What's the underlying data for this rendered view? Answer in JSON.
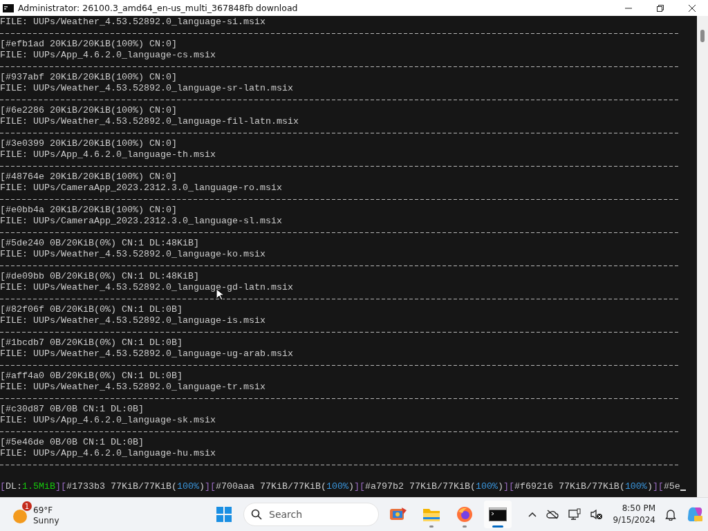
{
  "window": {
    "title": "Administrator:  26100.3_amd64_en-us_multi_367848fb download"
  },
  "console": {
    "first_line": "FILE: UUPs/Weather_4.53.52892.0_language-si.msix",
    "records": [
      {
        "header": "[#efb1ad 20KiB/20KiB(100%) CN:0]",
        "file": "FILE: UUPs/App_4.6.2.0_language-cs.msix"
      },
      {
        "header": "[#937abf 20KiB/20KiB(100%) CN:0]",
        "file": "FILE: UUPs/Weather_4.53.52892.0_language-sr-latn.msix"
      },
      {
        "header": "[#6e2286 20KiB/20KiB(100%) CN:0]",
        "file": "FILE: UUPs/Weather_4.53.52892.0_language-fil-latn.msix"
      },
      {
        "header": "[#3e0399 20KiB/20KiB(100%) CN:0]",
        "file": "FILE: UUPs/App_4.6.2.0_language-th.msix"
      },
      {
        "header": "[#48764e 20KiB/20KiB(100%) CN:0]",
        "file": "FILE: UUPs/CameraApp_2023.2312.3.0_language-ro.msix"
      },
      {
        "header": "[#e0bb4a 20KiB/20KiB(100%) CN:0]",
        "file": "FILE: UUPs/CameraApp_2023.2312.3.0_language-sl.msix"
      },
      {
        "header": "[#5de240 0B/20KiB(0%) CN:1 DL:48KiB]",
        "file": "FILE: UUPs/Weather_4.53.52892.0_language-ko.msix"
      },
      {
        "header": "[#de09bb 0B/20KiB(0%) CN:1 DL:48KiB]",
        "file": "FILE: UUPs/Weather_4.53.52892.0_language-gd-latn.msix"
      },
      {
        "header": "[#82f06f 0B/20KiB(0%) CN:1 DL:0B]",
        "file": "FILE: UUPs/Weather_4.53.52892.0_language-is.msix"
      },
      {
        "header": "[#1bcdb7 0B/20KiB(0%) CN:1 DL:0B]",
        "file": "FILE: UUPs/Weather_4.53.52892.0_language-ug-arab.msix"
      },
      {
        "header": "[#aff4a0 0B/20KiB(0%) CN:1 DL:0B]",
        "file": "FILE: UUPs/Weather_4.53.52892.0_language-tr.msix"
      },
      {
        "header": "[#c30d87 0B/0B CN:1 DL:0B]",
        "file": "FILE: UUPs/App_4.6.2.0_language-sk.msix"
      },
      {
        "header": "[#5e46de 0B/0B CN:1 DL:0B]",
        "file": "FILE: UUPs/App_4.6.2.0_language-hu.msix"
      }
    ],
    "status": [
      {
        "text": "[",
        "kind": "bracket"
      },
      {
        "text": "DL:",
        "kind": "plain"
      },
      {
        "text": "1.5MiB",
        "kind": "green"
      },
      {
        "text": "][",
        "kind": "bracket"
      },
      {
        "text": "#1733b3 77KiB/77KiB",
        "kind": "plain"
      },
      {
        "text": "(",
        "kind": "plain"
      },
      {
        "text": "100%",
        "kind": "blue"
      },
      {
        "text": ")",
        "kind": "plain"
      },
      {
        "text": "][",
        "kind": "bracket"
      },
      {
        "text": "#700aaa 77KiB/77KiB",
        "kind": "plain"
      },
      {
        "text": "(",
        "kind": "plain"
      },
      {
        "text": "100%",
        "kind": "blue"
      },
      {
        "text": ")",
        "kind": "plain"
      },
      {
        "text": "][",
        "kind": "bracket"
      },
      {
        "text": "#a797b2 77KiB/77KiB",
        "kind": "plain"
      },
      {
        "text": "(",
        "kind": "plain"
      },
      {
        "text": "100%",
        "kind": "blue"
      },
      {
        "text": ")",
        "kind": "plain"
      },
      {
        "text": "][",
        "kind": "bracket"
      },
      {
        "text": "#f69216 77KiB/77KiB",
        "kind": "plain"
      },
      {
        "text": "(",
        "kind": "plain"
      },
      {
        "text": "100%",
        "kind": "blue"
      },
      {
        "text": ")",
        "kind": "plain"
      },
      {
        "text": "][",
        "kind": "bracket"
      },
      {
        "text": "#5e",
        "kind": "plain"
      }
    ]
  },
  "taskbar": {
    "weather": {
      "badge": "1",
      "temperature": "69°F",
      "condition": "Sunny"
    },
    "search": {
      "placeholder": "Search"
    },
    "apps": [
      {
        "kind": "folder",
        "active": false
      },
      {
        "kind": "browser",
        "active": false
      },
      {
        "kind": "terminal",
        "active": true
      }
    ],
    "time": "8:50 PM",
    "date": "9/15/2024"
  }
}
